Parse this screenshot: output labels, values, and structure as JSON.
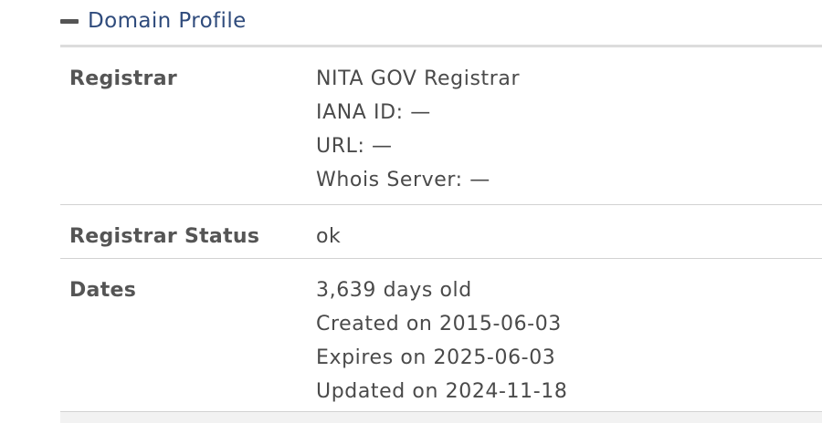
{
  "section": {
    "title": "Domain Profile",
    "icon": "minus-icon"
  },
  "rows": [
    {
      "label": "Registrar",
      "values": [
        "NITA GOV Registrar",
        "IANA ID: —",
        "URL: —",
        "Whois Server: —"
      ]
    },
    {
      "label": "Registrar Status",
      "values": [
        "ok"
      ]
    },
    {
      "label": "Dates",
      "values": [
        "3,639 days old",
        "Created on 2015-06-03",
        "Expires on 2025-06-03",
        "Updated on 2024-11-18"
      ]
    }
  ],
  "colors": {
    "title": "#2f4b7c",
    "label": "#555555",
    "value": "#4a4a4a",
    "divider": "#d2d2d2"
  }
}
